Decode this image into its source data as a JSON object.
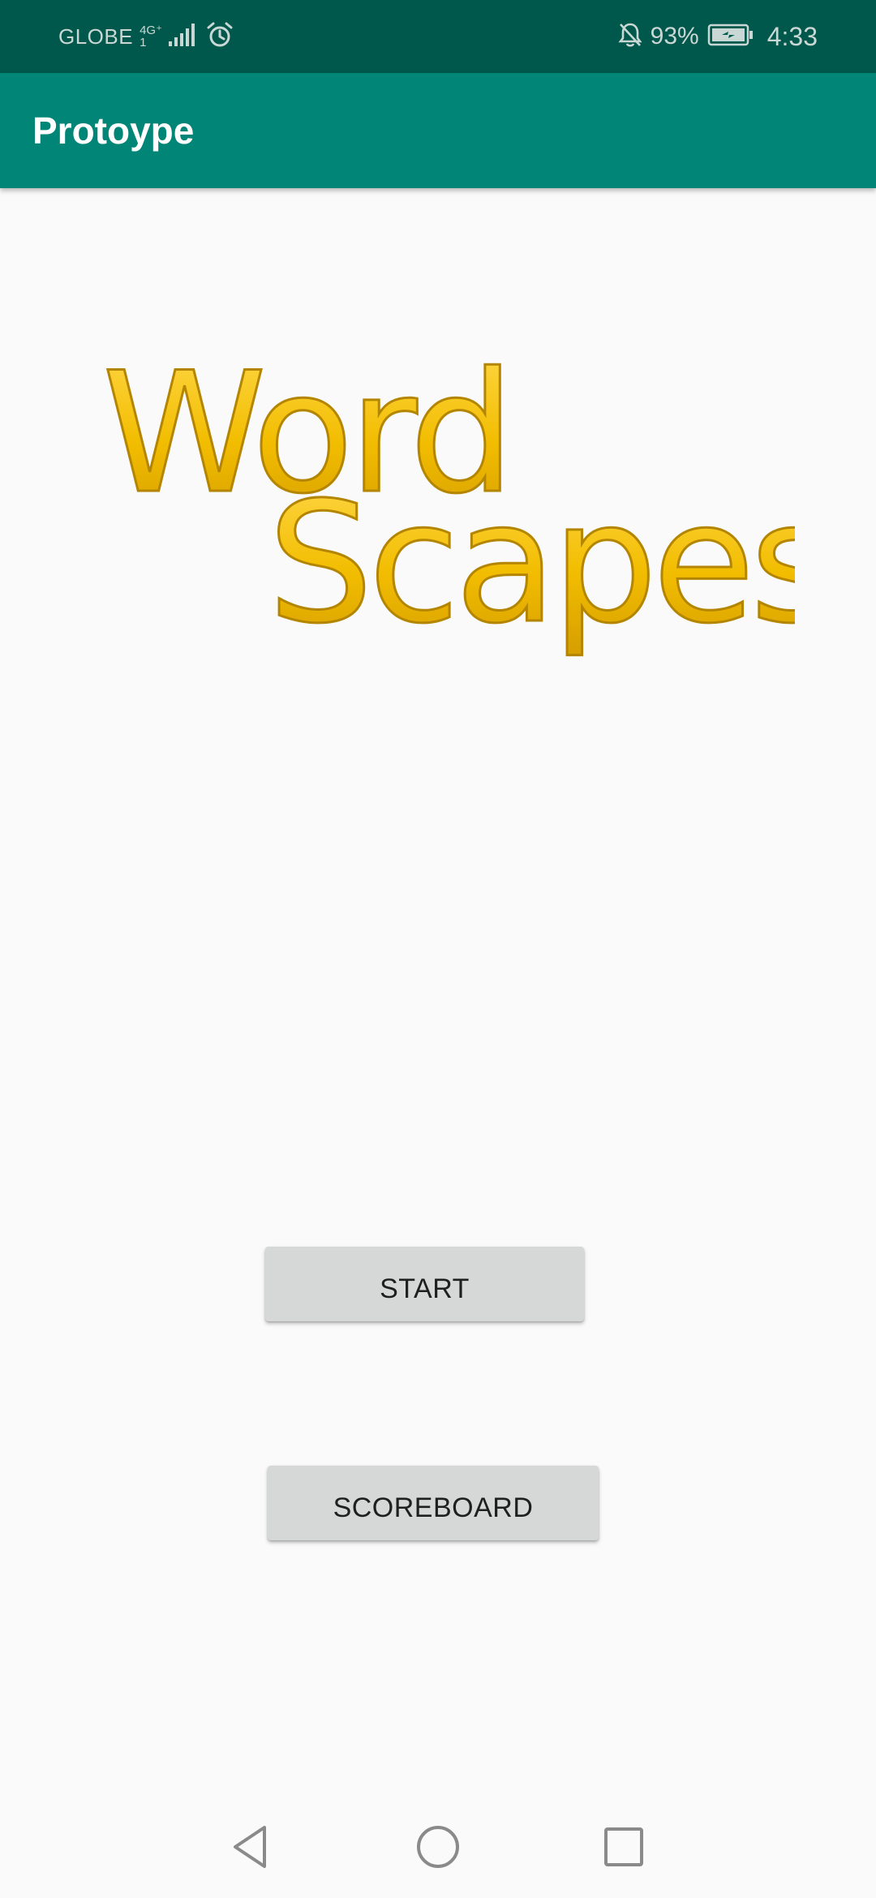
{
  "status_bar": {
    "carrier": "GLOBE",
    "network_type_top": "4G⁺",
    "network_type_bottom": "1",
    "icons": [
      "signal-icon",
      "alarm-icon",
      "notifications-off-icon",
      "battery-charging-icon"
    ],
    "battery_percent": "93%",
    "time": "4:33"
  },
  "app_bar": {
    "title": "Protoype"
  },
  "logo": {
    "line1": "Word",
    "line2": "Scapes",
    "color": "#f2bd00"
  },
  "buttons": {
    "start_label": "START",
    "scoreboard_label": "SCOREBOARD"
  },
  "nav_bar": {
    "icons": [
      "back-icon",
      "home-icon",
      "recents-icon"
    ]
  },
  "colors": {
    "status_bar": "#00574b",
    "app_bar": "#008577",
    "background": "#fafafa",
    "button": "#d6d7d7"
  }
}
